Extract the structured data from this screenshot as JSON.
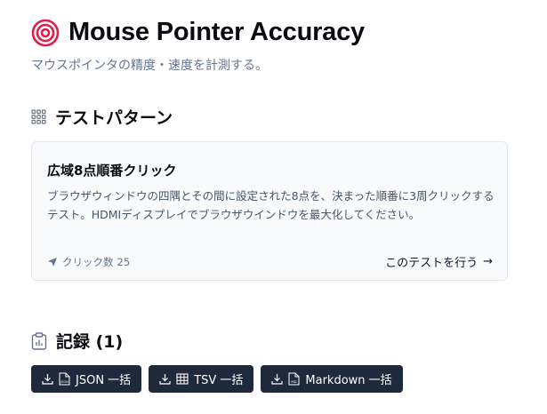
{
  "header": {
    "title": "Mouse Pointer Accuracy",
    "subtitle": "マウスポインタの精度・速度を計測する。"
  },
  "test_patterns": {
    "heading": "テストパターン",
    "card": {
      "title": "広域8点順番クリック",
      "description": "ブラウザウィンドウの四隅とその間に設定された8点を、決まった順番に3周クリックするテスト。HDMIディスプレイでブラウザウインドウを最大化してください。",
      "click_label": "クリック数",
      "click_count": "25",
      "start_label": "このテストを行う",
      "start_arrow": "→"
    }
  },
  "records": {
    "heading": "記録 (1)",
    "buttons": [
      {
        "label": "JSON 一括",
        "file_icon_text": "JSON"
      },
      {
        "label": "TSV 一括"
      },
      {
        "label": "Markdown 一括",
        "file_icon_text": "MD"
      }
    ]
  },
  "colors": {
    "accent": "#e11d48",
    "button_bg": "#1e293b",
    "card_bg": "#f8fafc",
    "card_border": "#e2e8f0",
    "muted_text": "#64748b"
  }
}
